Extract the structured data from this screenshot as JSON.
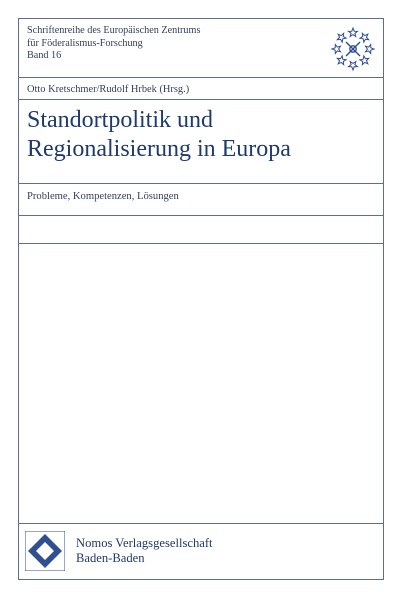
{
  "series": {
    "line1": "Schriftenreihe des Europäischen Zentrums",
    "line2": "für Föderalismus-Forschung",
    "volume": "Band 16"
  },
  "authors": "Otto Kretschmer/Rudolf Hrbek (Hrsg.)",
  "title": {
    "line1": "Standortpolitik und",
    "line2": "Regionalisierung in Europa"
  },
  "subtitle": "Probleme, Kompetenzen, Lösungen",
  "publisher": {
    "line1": "Nomos Verlagsgesellschaft",
    "line2": "Baden-Baden"
  },
  "colors": {
    "frame": "#5b6f95",
    "title_text": "#1f3a6d",
    "logo_blue": "#2f4f8f"
  }
}
